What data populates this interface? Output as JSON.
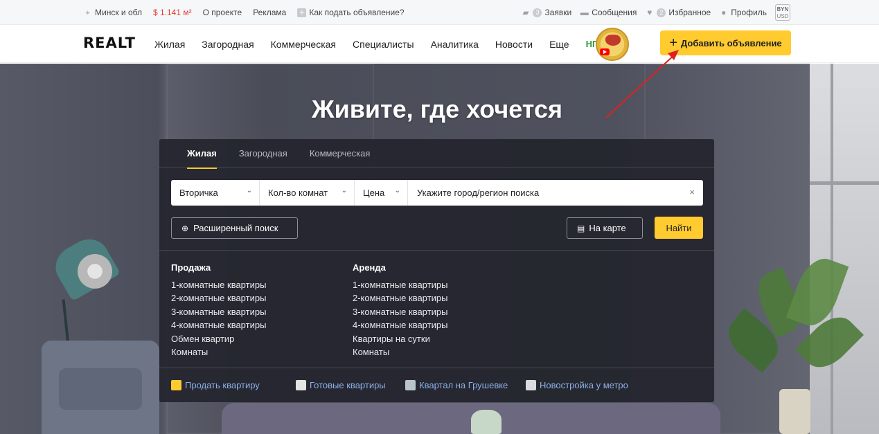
{
  "topbar": {
    "location": "Минск и обл",
    "price": "$ 1.141 м²",
    "about": "О проекте",
    "ads": "Реклама",
    "how_to_post": "Как подать объявление?",
    "requests_count": "3",
    "requests": "Заявки",
    "messages": "Сообщения",
    "favorites_count": "2",
    "favorites": "Избранное",
    "profile": "Профиль",
    "currency_top": "BYN",
    "currency_bottom": "USD"
  },
  "nav": {
    "logo": "REALT",
    "links": [
      "Жилая",
      "Загородная",
      "Коммерческая",
      "Специалисты",
      "Аналитика",
      "Новости",
      "Еще"
    ],
    "ng": "НГ",
    "add_button": "Добавить объявление"
  },
  "hero": {
    "title": "Живите, где хочется"
  },
  "search": {
    "tabs": [
      "Жилая",
      "Загородная",
      "Коммерческая"
    ],
    "type_select": "Вторичка",
    "rooms_select": "Кол-во комнат",
    "price_select": "Цена",
    "location_placeholder": "Укажите город/регион поиска",
    "advanced": "Расширенный поиск",
    "map": "На карте",
    "find": "Найти"
  },
  "links": {
    "sale": {
      "title": "Продажа",
      "items": [
        "1-комнатные квартиры",
        "2-комнатные квартиры",
        "3-комнатные квартиры",
        "4-комнатные квартиры",
        "Обмен квартир",
        "Комнаты"
      ]
    },
    "rent": {
      "title": "Аренда",
      "items": [
        "1-комнатные квартиры",
        "2-комнатные квартиры",
        "3-комнатные квартиры",
        "4-комнатные квартиры",
        "Квартиры на сутки",
        "Комнаты"
      ]
    }
  },
  "quicklinks": [
    "Продать квартиру",
    "Готовые квартиры",
    "Квартал на Грушевке",
    "Новостройка у метро"
  ],
  "colors": {
    "accent": "#ffcb2f",
    "price": "#e53935",
    "link": "#8bb0e8",
    "annotation_arrow": "#e02020"
  }
}
